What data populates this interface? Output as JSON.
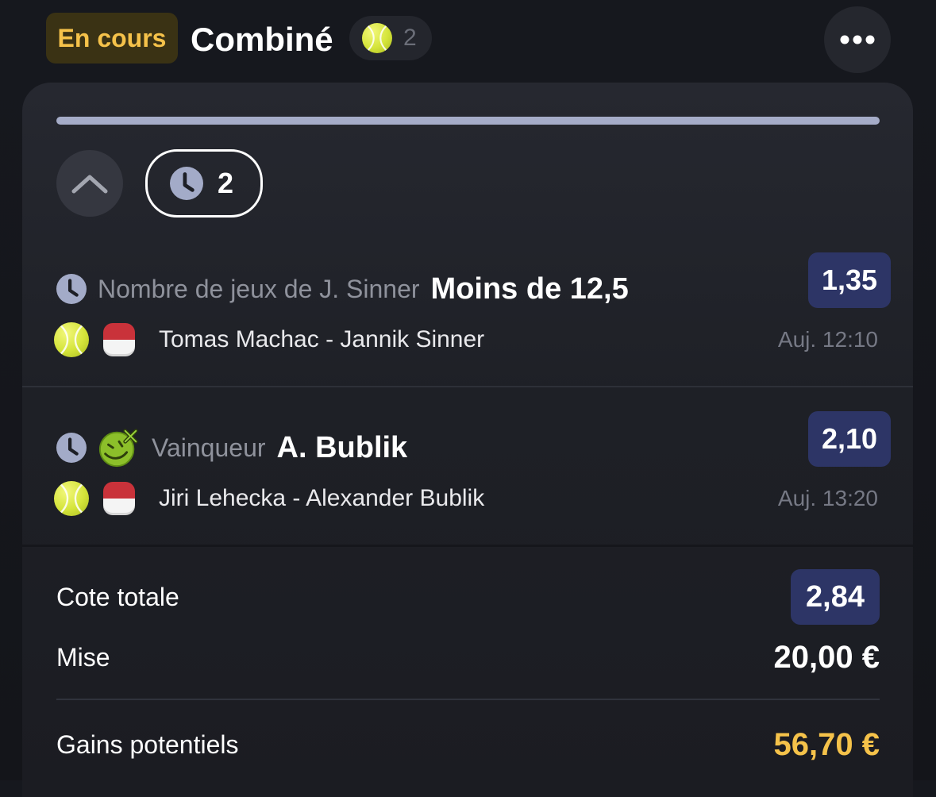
{
  "header": {
    "status_label": "En cours",
    "bet_type": "Combiné",
    "sport_icon": "tennis-ball-icon",
    "selection_count": "2",
    "more_icon": "ellipsis-icon"
  },
  "card": {
    "progress_fraction": 0,
    "collapse_icon": "chevron-up-icon",
    "pending_icon": "clock-icon",
    "pending_count": "2"
  },
  "selections": [
    {
      "status_icon": "clock-icon",
      "market": "Nombre de jeux de J. Sinner",
      "pick": "Moins de 12,5",
      "odds": "1,35",
      "sport_icon": "tennis-ball-icon",
      "flag_icon": "flag-icon",
      "event": "Tomas Machac - Jannik Sinner",
      "time": "Auj. 12:10"
    },
    {
      "status_icon": "clock-icon",
      "extra_icon": "boost-emoji-icon",
      "market": "Vainqueur",
      "pick": "A. Bublik",
      "odds": "2,10",
      "sport_icon": "tennis-ball-icon",
      "flag_icon": "flag-icon",
      "event": "Jiri Lehecka - Alexander Bublik",
      "time": "Auj. 13:20"
    }
  ],
  "summary": {
    "total_odds_label": "Cote totale",
    "total_odds": "2,84",
    "stake_label": "Mise",
    "stake": "20,00 €",
    "winnings_label": "Gains potentiels",
    "winnings": "56,70 €"
  },
  "colors": {
    "accent_gold": "#f5c24a",
    "odds_badge_bg": "#2d3566",
    "status_badge_bg": "#3a3214",
    "progress_bar": "#a5acc8"
  }
}
